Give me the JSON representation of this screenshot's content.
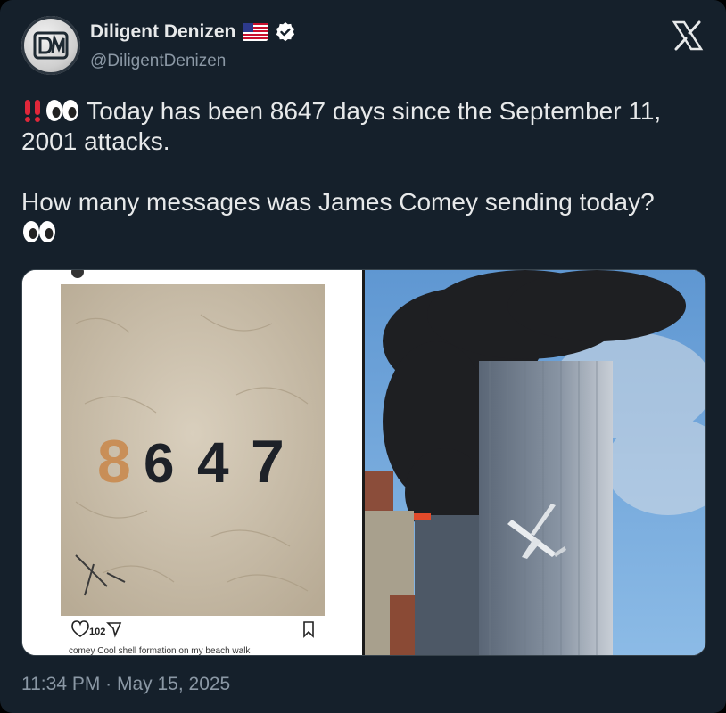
{
  "tweet": {
    "display_name": "Diligent Denizen",
    "handle": "@DiligentDenizen",
    "line1": " Today has been 8647 days since the September 11,",
    "line2": "2001 attacks.",
    "line3": "How many messages was James Comey sending today?",
    "timestamp": "11:34 PM · May 15, 2025"
  },
  "media": {
    "left_image": {
      "number_in_sand": "8647",
      "likes": "102",
      "caption": "comey Cool shell formation on my beach walk"
    }
  },
  "icons": {
    "flag": "us-flag-icon",
    "verified": "verified-badge-icon",
    "x_logo": "x-logo-icon",
    "exclamation": "double-exclamation-icon",
    "eyes": "eyes-icon",
    "heart": "heart-icon",
    "share": "send-icon",
    "bookmark": "bookmark-icon"
  },
  "colors": {
    "background": "#15202b",
    "text": "#e7e9ea",
    "muted": "#8b98a5",
    "verified": "#ffffff"
  }
}
